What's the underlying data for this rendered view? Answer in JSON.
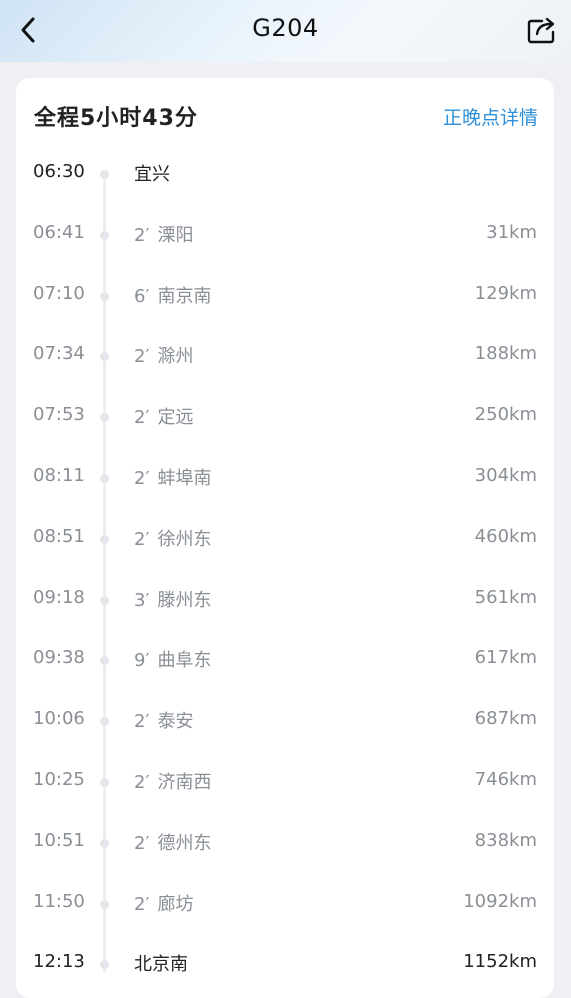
{
  "header": {
    "title": "G204",
    "back_icon": "chevron-left-icon",
    "share_icon": "share-icon"
  },
  "summary": {
    "duration": "全程5小时43分",
    "delay_link": "正晚点详情",
    "link_color": "#2f8fd8"
  },
  "stops": [
    {
      "time": "06:30",
      "stay": "",
      "name": "宜兴",
      "distance": ""
    },
    {
      "time": "06:41",
      "stay": "2′",
      "name": "溧阳",
      "distance": "31km"
    },
    {
      "time": "07:10",
      "stay": "6′",
      "name": "南京南",
      "distance": "129km"
    },
    {
      "time": "07:34",
      "stay": "2′",
      "name": "滁州",
      "distance": "188km"
    },
    {
      "time": "07:53",
      "stay": "2′",
      "name": "定远",
      "distance": "250km"
    },
    {
      "time": "08:11",
      "stay": "2′",
      "name": "蚌埠南",
      "distance": "304km"
    },
    {
      "time": "08:51",
      "stay": "2′",
      "name": "徐州东",
      "distance": "460km"
    },
    {
      "time": "09:18",
      "stay": "3′",
      "name": "滕州东",
      "distance": "561km"
    },
    {
      "time": "09:38",
      "stay": "9′",
      "name": "曲阜东",
      "distance": "617km"
    },
    {
      "time": "10:06",
      "stay": "2′",
      "name": "泰安",
      "distance": "687km"
    },
    {
      "time": "10:25",
      "stay": "2′",
      "name": "济南西",
      "distance": "746km"
    },
    {
      "time": "10:51",
      "stay": "2′",
      "name": "德州东",
      "distance": "838km"
    },
    {
      "time": "11:50",
      "stay": "2′",
      "name": "廊坊",
      "distance": "1092km"
    },
    {
      "time": "12:13",
      "stay": "",
      "name": "北京南",
      "distance": "1152km"
    }
  ]
}
